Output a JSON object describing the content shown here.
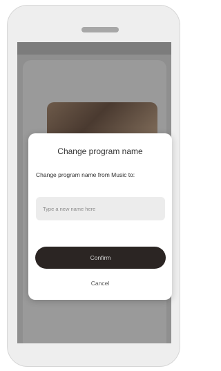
{
  "dialog": {
    "title": "Change program name",
    "message": "Change program name from Music to:",
    "input_placeholder": "Type a new name here",
    "input_value": "",
    "confirm_label": "Confirm",
    "cancel_label": "Cancel"
  },
  "colors": {
    "overlay": "#8f8f8f",
    "dialog_background": "#ffffff",
    "confirm_button": "#2b2523",
    "input_background": "#ececec"
  }
}
